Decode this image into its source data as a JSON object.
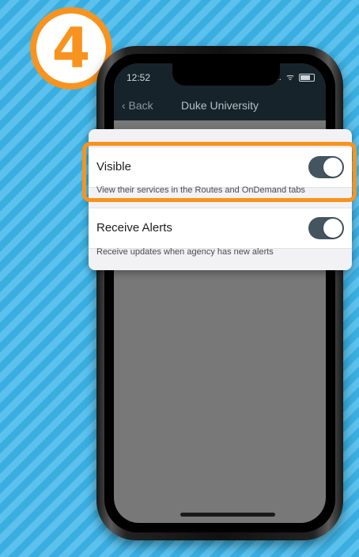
{
  "step_number": "4",
  "status_bar": {
    "time": "12:52",
    "indicator": "...."
  },
  "nav": {
    "back_label": "‹ Back",
    "title": "Duke University"
  },
  "settings": [
    {
      "label": "Visible",
      "description": "View their services in the Routes and OnDemand tabs",
      "enabled": true
    },
    {
      "label": "Receive Alerts",
      "description": "Receive updates when agency has new alerts",
      "enabled": true
    }
  ],
  "colors": {
    "accent": "#f7931e",
    "toggle_on": "#445560",
    "navbar": "#17232a",
    "background": "#3aaee0"
  }
}
